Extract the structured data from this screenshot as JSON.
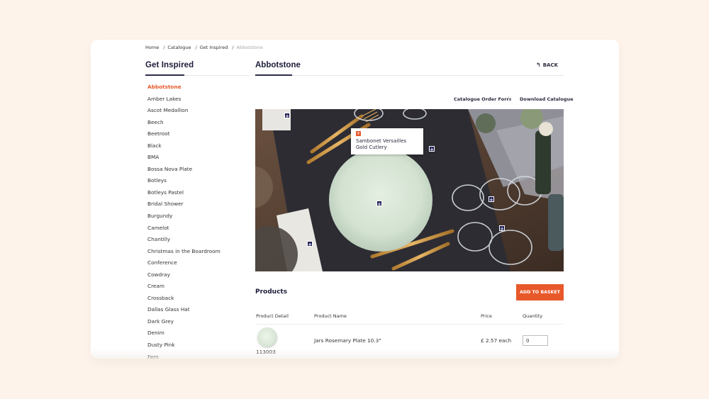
{
  "breadcrumb": {
    "items": [
      "Home",
      "Catalogue",
      "Get Inspired"
    ],
    "current": "Abbotstone",
    "separator": "/"
  },
  "sidebar": {
    "title": "Get Inspired",
    "items": [
      "Abbotstone",
      "Amber Lakes",
      "Ascot Medallion",
      "Beech",
      "Beetroot",
      "Black",
      "BMA",
      "Bossa Nova Plate",
      "Botleys",
      "Botleys Pastel",
      "Bridal Shower",
      "Burgundy",
      "Camelot",
      "Chantilly",
      "Christmas in the Boardroom",
      "Conference",
      "Cowdray",
      "Cream",
      "Crossback",
      "Dallas Glass Hat",
      "Dark Grey",
      "Denim",
      "Dusty Pink",
      "Fern"
    ],
    "active_index": 0
  },
  "main": {
    "title": "Abbotstone",
    "back_label": "BACK",
    "links": {
      "order_form": "Catalogue Order Form",
      "download": "Download Catalogue"
    }
  },
  "hotspots": {
    "icon": "plus-icon",
    "tooltip_text": "Sambonet Versailles Gold Cutlery"
  },
  "products": {
    "title": "Products",
    "add_button": "ADD TO BASKET",
    "headers": {
      "detail": "Product Detail",
      "name": "Product Name",
      "price": "Price",
      "quantity": "Quantity"
    },
    "rows": [
      {
        "code": "113003",
        "name": "Jars Rosemary Plate 10.3\"",
        "price": "£ 2.57 each",
        "quantity": "0"
      }
    ]
  },
  "colors": {
    "accent": "#e8582a",
    "navy": "#1d1d56",
    "background": "#fdf3ea"
  }
}
